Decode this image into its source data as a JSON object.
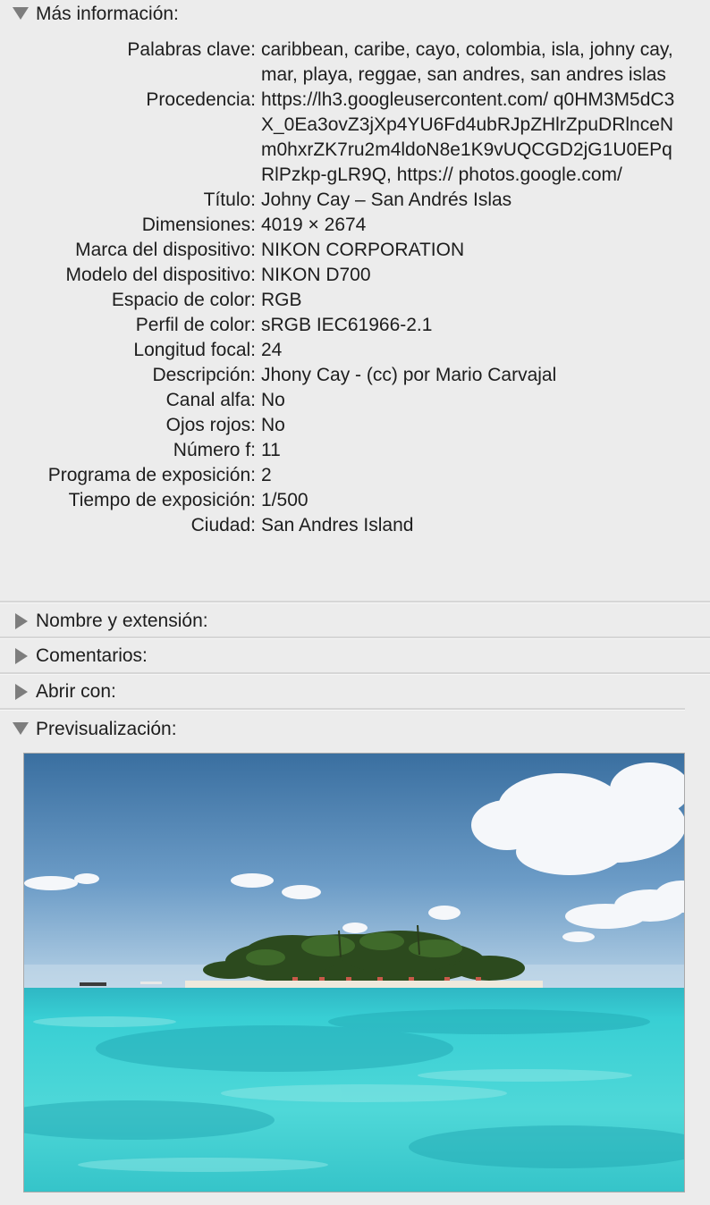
{
  "sections": {
    "more_info": {
      "label": "Más información:",
      "expanded": true
    },
    "name_ext": {
      "label": "Nombre y extensión:",
      "expanded": false
    },
    "comments": {
      "label": "Comentarios:",
      "expanded": false
    },
    "open_with": {
      "label": "Abrir con:",
      "expanded": false
    },
    "preview": {
      "label": "Previsualización:",
      "expanded": true
    }
  },
  "metadata": [
    {
      "label": "Palabras clave:",
      "value": "caribbean, caribe, cayo, colombia, isla, johny cay, mar, playa, reggae, san andres, san andres islas"
    },
    {
      "label": "Procedencia:",
      "value": "https://lh3.googleusercontent.com/ q0HM3M5dC3X_0Ea3ovZ3jXp4YU6Fd4ubRJpZHlrZpuDRlnceNm0hxrZK7ru2m4ldoN8e1K9vUQCGD2jG1U0EPqRlPzkp-gLR9Q, https:// photos.google.com/"
    },
    {
      "label": "Título:",
      "value": "Johny Cay – San Andrés Islas"
    },
    {
      "label": "Dimensiones:",
      "value": "4019 × 2674"
    },
    {
      "label": "Marca del dispositivo:",
      "value": "NIKON CORPORATION"
    },
    {
      "label": "Modelo del dispositivo:",
      "value": "NIKON D700"
    },
    {
      "label": "Espacio de color:",
      "value": "RGB"
    },
    {
      "label": "Perfil de color:",
      "value": "sRGB IEC61966-2.1"
    },
    {
      "label": "Longitud focal:",
      "value": "24"
    },
    {
      "label": "Descripción:",
      "value": "Jhony Cay - (cc) por Mario Carvajal"
    },
    {
      "label": "Canal alfa:",
      "value": "No"
    },
    {
      "label": "Ojos rojos:",
      "value": "No"
    },
    {
      "label": "Número f:",
      "value": "11"
    },
    {
      "label": "Programa de exposición:",
      "value": "2"
    },
    {
      "label": "Tiempo de exposición:",
      "value": "1/500"
    },
    {
      "label": "Ciudad:",
      "value": "San Andres Island"
    }
  ],
  "icons": {
    "expanded": "disclosure-triangle-down-icon",
    "collapsed": "disclosure-triangle-right-icon"
  },
  "colors": {
    "background": "#ececec",
    "disclosure": "#7d7d7d",
    "sky_top": "#3c74a4",
    "sea": "#3fd0d4"
  }
}
